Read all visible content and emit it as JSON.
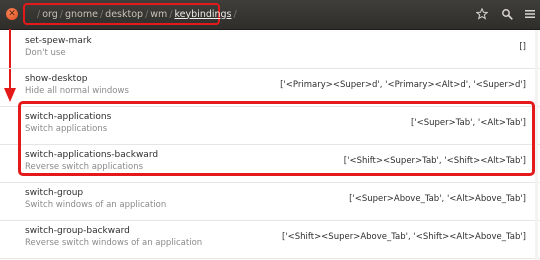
{
  "headerbar": {
    "path": [
      {
        "label": "org",
        "current": false
      },
      {
        "label": "gnome",
        "current": false
      },
      {
        "label": "desktop",
        "current": false
      },
      {
        "label": "wm",
        "current": false
      },
      {
        "label": "keybindings",
        "current": true
      }
    ],
    "separator": "/",
    "buttons": [
      "star-icon",
      "search-icon",
      "menu-icon"
    ]
  },
  "rows": [
    {
      "name": "set-spew-mark",
      "summary": "Don't use",
      "value": "[]"
    },
    {
      "name": "show-desktop",
      "summary": "Hide all normal windows",
      "value": "['<Primary><Super>d', '<Primary><Alt>d', '<Super>d']"
    },
    {
      "name": "switch-applications",
      "summary": "Switch applications",
      "value": "['<Super>Tab', '<Alt>Tab']"
    },
    {
      "name": "switch-applications-backward",
      "summary": "Reverse switch applications",
      "value": "['<Shift><Super>Tab', '<Shift><Alt>Tab']"
    },
    {
      "name": "switch-group",
      "summary": "Switch windows of an application",
      "value": "['<Super>Above_Tab', '<Alt>Above_Tab']"
    },
    {
      "name": "switch-group-backward",
      "summary": "Reverse switch windows of an application",
      "value": "['<Shift><Super>Above_Tab', '<Shift><Alt>Above_Tab']"
    }
  ],
  "colors": {
    "annotation_red": "#e3191a",
    "headerbar_bg": "#3a3935",
    "close_button": "#e9541f"
  }
}
